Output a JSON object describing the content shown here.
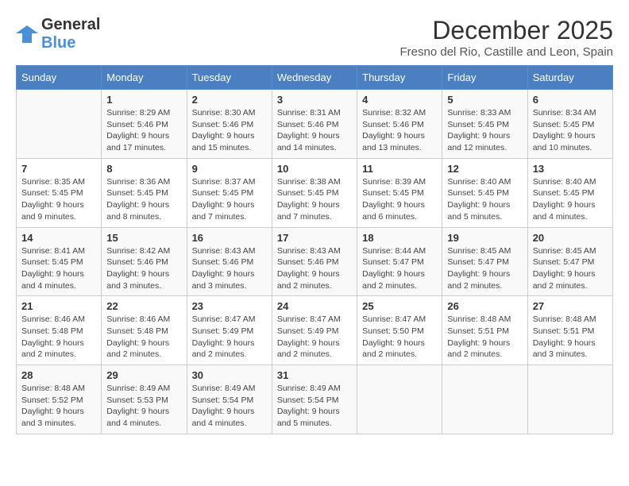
{
  "logo": {
    "general": "General",
    "blue": "Blue"
  },
  "title": "December 2025",
  "location": "Fresno del Rio, Castille and Leon, Spain",
  "headers": [
    "Sunday",
    "Monday",
    "Tuesday",
    "Wednesday",
    "Thursday",
    "Friday",
    "Saturday"
  ],
  "weeks": [
    [
      {
        "day": "",
        "sunrise": "",
        "sunset": "",
        "daylight": ""
      },
      {
        "day": "1",
        "sunrise": "Sunrise: 8:29 AM",
        "sunset": "Sunset: 5:46 PM",
        "daylight": "Daylight: 9 hours and 17 minutes."
      },
      {
        "day": "2",
        "sunrise": "Sunrise: 8:30 AM",
        "sunset": "Sunset: 5:46 PM",
        "daylight": "Daylight: 9 hours and 15 minutes."
      },
      {
        "day": "3",
        "sunrise": "Sunrise: 8:31 AM",
        "sunset": "Sunset: 5:46 PM",
        "daylight": "Daylight: 9 hours and 14 minutes."
      },
      {
        "day": "4",
        "sunrise": "Sunrise: 8:32 AM",
        "sunset": "Sunset: 5:46 PM",
        "daylight": "Daylight: 9 hours and 13 minutes."
      },
      {
        "day": "5",
        "sunrise": "Sunrise: 8:33 AM",
        "sunset": "Sunset: 5:45 PM",
        "daylight": "Daylight: 9 hours and 12 minutes."
      },
      {
        "day": "6",
        "sunrise": "Sunrise: 8:34 AM",
        "sunset": "Sunset: 5:45 PM",
        "daylight": "Daylight: 9 hours and 10 minutes."
      }
    ],
    [
      {
        "day": "7",
        "sunrise": "Sunrise: 8:35 AM",
        "sunset": "Sunset: 5:45 PM",
        "daylight": "Daylight: 9 hours and 9 minutes."
      },
      {
        "day": "8",
        "sunrise": "Sunrise: 8:36 AM",
        "sunset": "Sunset: 5:45 PM",
        "daylight": "Daylight: 9 hours and 8 minutes."
      },
      {
        "day": "9",
        "sunrise": "Sunrise: 8:37 AM",
        "sunset": "Sunset: 5:45 PM",
        "daylight": "Daylight: 9 hours and 7 minutes."
      },
      {
        "day": "10",
        "sunrise": "Sunrise: 8:38 AM",
        "sunset": "Sunset: 5:45 PM",
        "daylight": "Daylight: 9 hours and 7 minutes."
      },
      {
        "day": "11",
        "sunrise": "Sunrise: 8:39 AM",
        "sunset": "Sunset: 5:45 PM",
        "daylight": "Daylight: 9 hours and 6 minutes."
      },
      {
        "day": "12",
        "sunrise": "Sunrise: 8:40 AM",
        "sunset": "Sunset: 5:45 PM",
        "daylight": "Daylight: 9 hours and 5 minutes."
      },
      {
        "day": "13",
        "sunrise": "Sunrise: 8:40 AM",
        "sunset": "Sunset: 5:45 PM",
        "daylight": "Daylight: 9 hours and 4 minutes."
      }
    ],
    [
      {
        "day": "14",
        "sunrise": "Sunrise: 8:41 AM",
        "sunset": "Sunset: 5:45 PM",
        "daylight": "Daylight: 9 hours and 4 minutes."
      },
      {
        "day": "15",
        "sunrise": "Sunrise: 8:42 AM",
        "sunset": "Sunset: 5:46 PM",
        "daylight": "Daylight: 9 hours and 3 minutes."
      },
      {
        "day": "16",
        "sunrise": "Sunrise: 8:43 AM",
        "sunset": "Sunset: 5:46 PM",
        "daylight": "Daylight: 9 hours and 3 minutes."
      },
      {
        "day": "17",
        "sunrise": "Sunrise: 8:43 AM",
        "sunset": "Sunset: 5:46 PM",
        "daylight": "Daylight: 9 hours and 2 minutes."
      },
      {
        "day": "18",
        "sunrise": "Sunrise: 8:44 AM",
        "sunset": "Sunset: 5:47 PM",
        "daylight": "Daylight: 9 hours and 2 minutes."
      },
      {
        "day": "19",
        "sunrise": "Sunrise: 8:45 AM",
        "sunset": "Sunset: 5:47 PM",
        "daylight": "Daylight: 9 hours and 2 minutes."
      },
      {
        "day": "20",
        "sunrise": "Sunrise: 8:45 AM",
        "sunset": "Sunset: 5:47 PM",
        "daylight": "Daylight: 9 hours and 2 minutes."
      }
    ],
    [
      {
        "day": "21",
        "sunrise": "Sunrise: 8:46 AM",
        "sunset": "Sunset: 5:48 PM",
        "daylight": "Daylight: 9 hours and 2 minutes."
      },
      {
        "day": "22",
        "sunrise": "Sunrise: 8:46 AM",
        "sunset": "Sunset: 5:48 PM",
        "daylight": "Daylight: 9 hours and 2 minutes."
      },
      {
        "day": "23",
        "sunrise": "Sunrise: 8:47 AM",
        "sunset": "Sunset: 5:49 PM",
        "daylight": "Daylight: 9 hours and 2 minutes."
      },
      {
        "day": "24",
        "sunrise": "Sunrise: 8:47 AM",
        "sunset": "Sunset: 5:49 PM",
        "daylight": "Daylight: 9 hours and 2 minutes."
      },
      {
        "day": "25",
        "sunrise": "Sunrise: 8:47 AM",
        "sunset": "Sunset: 5:50 PM",
        "daylight": "Daylight: 9 hours and 2 minutes."
      },
      {
        "day": "26",
        "sunrise": "Sunrise: 8:48 AM",
        "sunset": "Sunset: 5:51 PM",
        "daylight": "Daylight: 9 hours and 2 minutes."
      },
      {
        "day": "27",
        "sunrise": "Sunrise: 8:48 AM",
        "sunset": "Sunset: 5:51 PM",
        "daylight": "Daylight: 9 hours and 3 minutes."
      }
    ],
    [
      {
        "day": "28",
        "sunrise": "Sunrise: 8:48 AM",
        "sunset": "Sunset: 5:52 PM",
        "daylight": "Daylight: 9 hours and 3 minutes."
      },
      {
        "day": "29",
        "sunrise": "Sunrise: 8:49 AM",
        "sunset": "Sunset: 5:53 PM",
        "daylight": "Daylight: 9 hours and 4 minutes."
      },
      {
        "day": "30",
        "sunrise": "Sunrise: 8:49 AM",
        "sunset": "Sunset: 5:54 PM",
        "daylight": "Daylight: 9 hours and 4 minutes."
      },
      {
        "day": "31",
        "sunrise": "Sunrise: 8:49 AM",
        "sunset": "Sunset: 5:54 PM",
        "daylight": "Daylight: 9 hours and 5 minutes."
      },
      {
        "day": "",
        "sunrise": "",
        "sunset": "",
        "daylight": ""
      },
      {
        "day": "",
        "sunrise": "",
        "sunset": "",
        "daylight": ""
      },
      {
        "day": "",
        "sunrise": "",
        "sunset": "",
        "daylight": ""
      }
    ]
  ]
}
